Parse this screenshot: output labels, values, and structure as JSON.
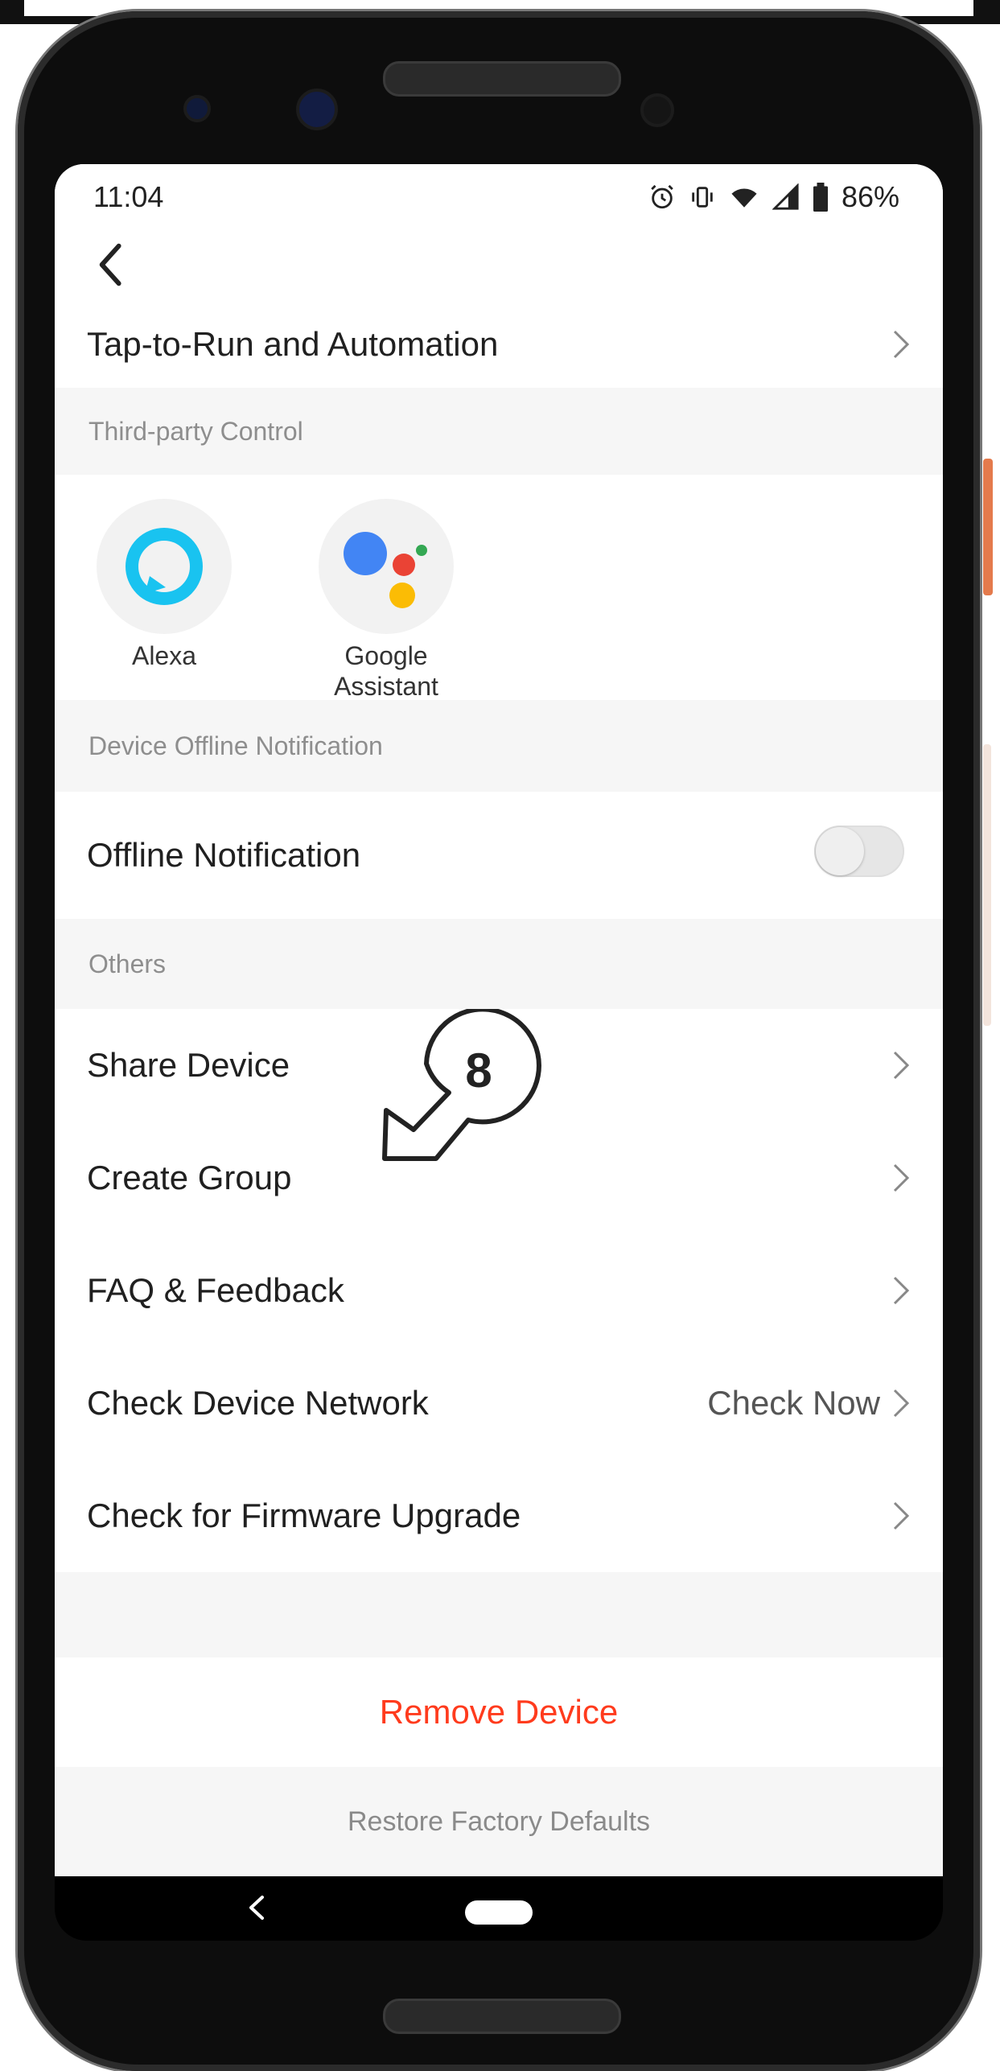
{
  "status_bar": {
    "time": "11:04",
    "battery": "86%",
    "icons": [
      "alarm-icon",
      "vibrate-icon",
      "wifi-icon",
      "signal-icon",
      "battery-icon"
    ]
  },
  "top_bar": {
    "back_icon": "chevron-left-icon"
  },
  "menu_top": {
    "tap_to_run": "Tap-to-Run and Automation"
  },
  "third_party": {
    "header": "Third-party Control",
    "items": [
      {
        "label": "Alexa",
        "icon": "alexa-icon"
      },
      {
        "label": "Google Assistant",
        "icon": "google-assistant-icon"
      }
    ]
  },
  "offline": {
    "header": "Device Offline Notification",
    "label": "Offline Notification",
    "toggle_on": false
  },
  "others": {
    "header": "Others",
    "items": [
      {
        "label": "Share Device",
        "value": ""
      },
      {
        "label": "Create Group",
        "value": ""
      },
      {
        "label": "FAQ & Feedback",
        "value": ""
      },
      {
        "label": "Check Device Network",
        "value": "Check Now"
      },
      {
        "label": "Check for Firmware Upgrade",
        "value": ""
      }
    ]
  },
  "actions": {
    "remove": "Remove Device",
    "restore": "Restore Factory Defaults"
  },
  "annotation": {
    "step": "8"
  },
  "colors": {
    "remove": "#ff3b1d",
    "alexa": "#00caff",
    "background": "#f6f6f6"
  }
}
